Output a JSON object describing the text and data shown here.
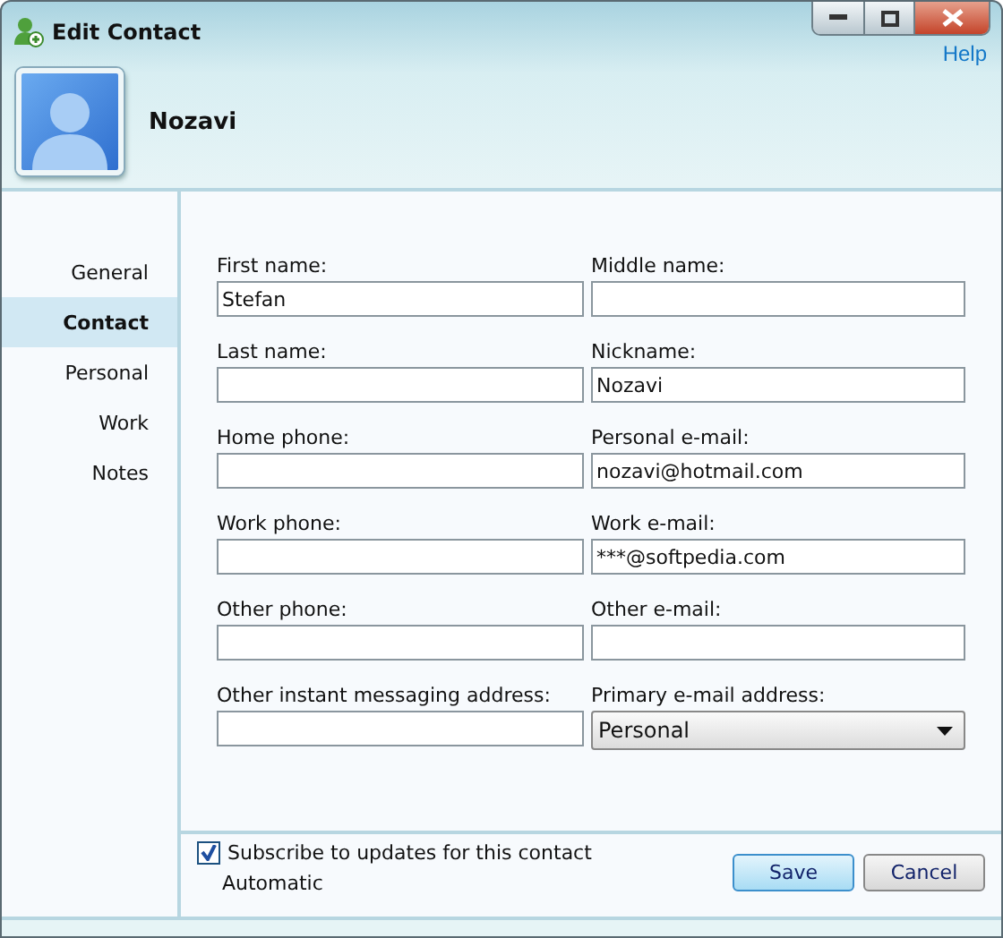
{
  "window": {
    "title": "Edit Contact",
    "help": "Help"
  },
  "contact": {
    "name": "Nozavi"
  },
  "sidebar": {
    "items": [
      {
        "label": "General",
        "selected": false
      },
      {
        "label": "Contact",
        "selected": true
      },
      {
        "label": "Personal",
        "selected": false
      },
      {
        "label": "Work",
        "selected": false
      },
      {
        "label": "Notes",
        "selected": false
      }
    ]
  },
  "fields": [
    {
      "kind": "text",
      "label": "First name:",
      "value": "Stefan"
    },
    {
      "kind": "text",
      "label": "Middle name:"
    },
    {
      "kind": "text",
      "label": "Last name:"
    },
    {
      "kind": "text",
      "label": "Nickname:",
      "value": "Nozavi"
    },
    {
      "kind": "text",
      "label": "Home phone:"
    },
    {
      "kind": "text",
      "label": "Personal e-mail:",
      "value": "nozavi@hotmail.com"
    },
    {
      "kind": "text",
      "label": "Work phone:"
    },
    {
      "kind": "text",
      "label": "Work e-mail:",
      "value": "***@softpedia.com"
    },
    {
      "kind": "text",
      "label": "Other phone:"
    },
    {
      "kind": "text",
      "label": "Other e-mail:"
    },
    {
      "kind": "text",
      "label": "Other instant messaging address:"
    },
    {
      "kind": "dropdown",
      "label": "Primary e-mail address:",
      "value": "Personal"
    }
  ],
  "subscribe": {
    "label": "Subscribe to updates for this contact",
    "checked": true,
    "note": "Automatic"
  },
  "buttons": [
    {
      "label": "Save",
      "default": true
    },
    {
      "label": "Cancel",
      "default": false
    }
  ]
}
